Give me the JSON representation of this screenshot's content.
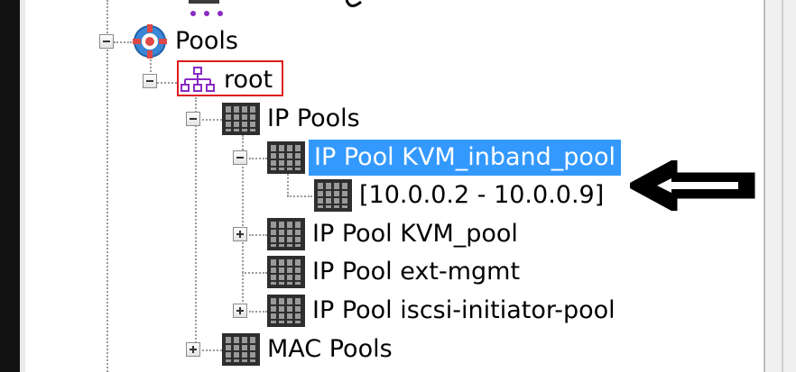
{
  "tree": {
    "pools": {
      "label": "Pools",
      "icon": "pools-icon"
    },
    "root": {
      "label": "root",
      "icon": "org-tree-icon"
    },
    "ip_pools": {
      "label": "IP Pools",
      "icon": "server-rack-icon"
    },
    "kvm_inband": {
      "label": "IP Pool KVM_inband_pool",
      "selected": true,
      "icon": "server-rack-icon"
    },
    "range": {
      "label": "[10.0.0.2 - 10.0.0.9]",
      "icon": "server-rack-icon"
    },
    "kvm_pool": {
      "label": "IP Pool KVM_pool",
      "icon": "server-rack-icon"
    },
    "ext_mgmt": {
      "label": "IP Pool ext-mgmt",
      "icon": "server-rack-icon"
    },
    "iscsi": {
      "label": "IP Pool iscsi-initiator-pool",
      "icon": "server-rack-icon"
    },
    "mac_pools": {
      "label": "MAC Pools",
      "icon": "server-rack-icon"
    }
  },
  "colors": {
    "selection": "#3399ff",
    "highlight_box": "#e01a1a",
    "arrow": "#000000"
  }
}
